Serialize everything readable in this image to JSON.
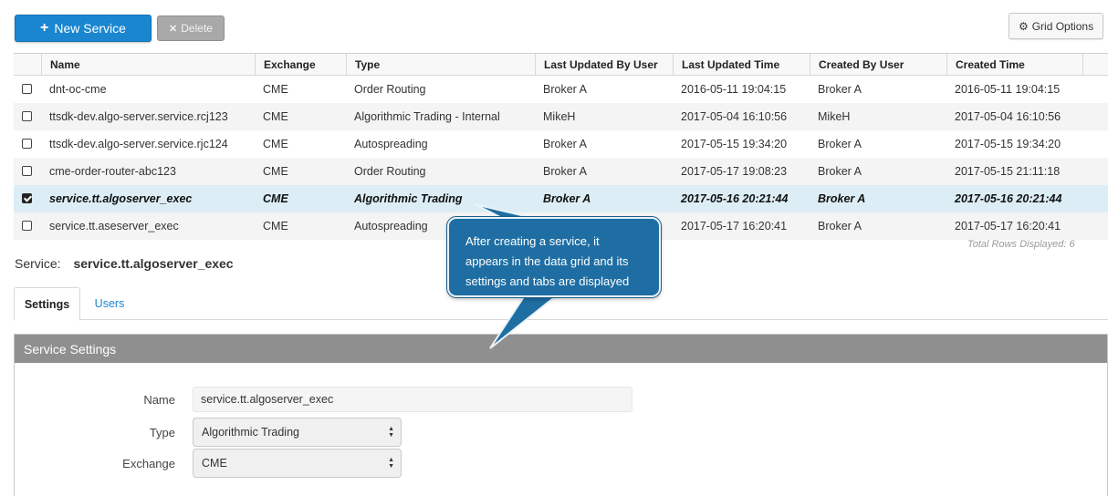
{
  "toolbar": {
    "new_label": "New Service",
    "delete_label": "Delete",
    "grid_options_label": "Grid Options"
  },
  "grid": {
    "columns": [
      "Name",
      "Exchange",
      "Type",
      "Last Updated By User",
      "Last Updated Time",
      "Created By User",
      "Created Time"
    ],
    "rows": [
      {
        "checked": false,
        "name": "dnt-oc-cme",
        "exchange": "CME",
        "type": "Order Routing",
        "updated_by": "Broker A",
        "updated_time": "2016-05-11 19:04:15",
        "created_by": "Broker A",
        "created_time": "2016-05-11 19:04:15"
      },
      {
        "checked": false,
        "name": "ttsdk-dev.algo-server.service.rcj123",
        "exchange": "CME",
        "type": "Algorithmic Trading - Internal",
        "updated_by": "MikeH",
        "updated_time": "2017-05-04 16:10:56",
        "created_by": "MikeH",
        "created_time": "2017-05-04 16:10:56"
      },
      {
        "checked": false,
        "name": "ttsdk-dev.algo-server.service.rjc124",
        "exchange": "CME",
        "type": "Autospreading",
        "updated_by": "Broker A",
        "updated_time": "2017-05-15 19:34:20",
        "created_by": "Broker A",
        "created_time": "2017-05-15 19:34:20"
      },
      {
        "checked": false,
        "name": "cme-order-router-abc123",
        "exchange": "CME",
        "type": "Order Routing",
        "updated_by": "Broker A",
        "updated_time": "2017-05-17 19:08:23",
        "created_by": "Broker A",
        "created_time": "2017-05-15 21:11:18"
      },
      {
        "checked": true,
        "name": "service.tt.algoserver_exec",
        "exchange": "CME",
        "type": "Algorithmic Trading",
        "updated_by": "Broker A",
        "updated_time": "2017-05-16 20:21:44",
        "created_by": "Broker A",
        "created_time": "2017-05-16 20:21:44"
      },
      {
        "checked": false,
        "name": "service.tt.aseserver_exec",
        "exchange": "CME",
        "type": "Autospreading",
        "updated_by": "",
        "updated_time": "2017-05-17 16:20:41",
        "created_by": "Broker A",
        "created_time": "2017-05-17 16:20:41"
      }
    ],
    "total_rows_text": "Total Rows Displayed: 6"
  },
  "service": {
    "label": "Service:",
    "value": "service.tt.algoserver_exec"
  },
  "tabs": [
    {
      "label": "Settings",
      "active": true
    },
    {
      "label": "Users",
      "active": false
    }
  ],
  "settings": {
    "title": "Service Settings",
    "name_label": "Name",
    "name_value": "service.tt.algoserver_exec",
    "type_label": "Type",
    "type_value": "Algorithmic Trading",
    "exchange_label": "Exchange",
    "exchange_value": "CME"
  },
  "callout": {
    "line1": "After creating a service, it",
    "line2": "appears in the data grid and its",
    "line3": "settings and tabs are displayed"
  },
  "colors": {
    "primary": "#1a86d0",
    "selected_row": "#dcedf5",
    "panel_header": "#8f8f8f",
    "callout": "#1f6ea3"
  }
}
